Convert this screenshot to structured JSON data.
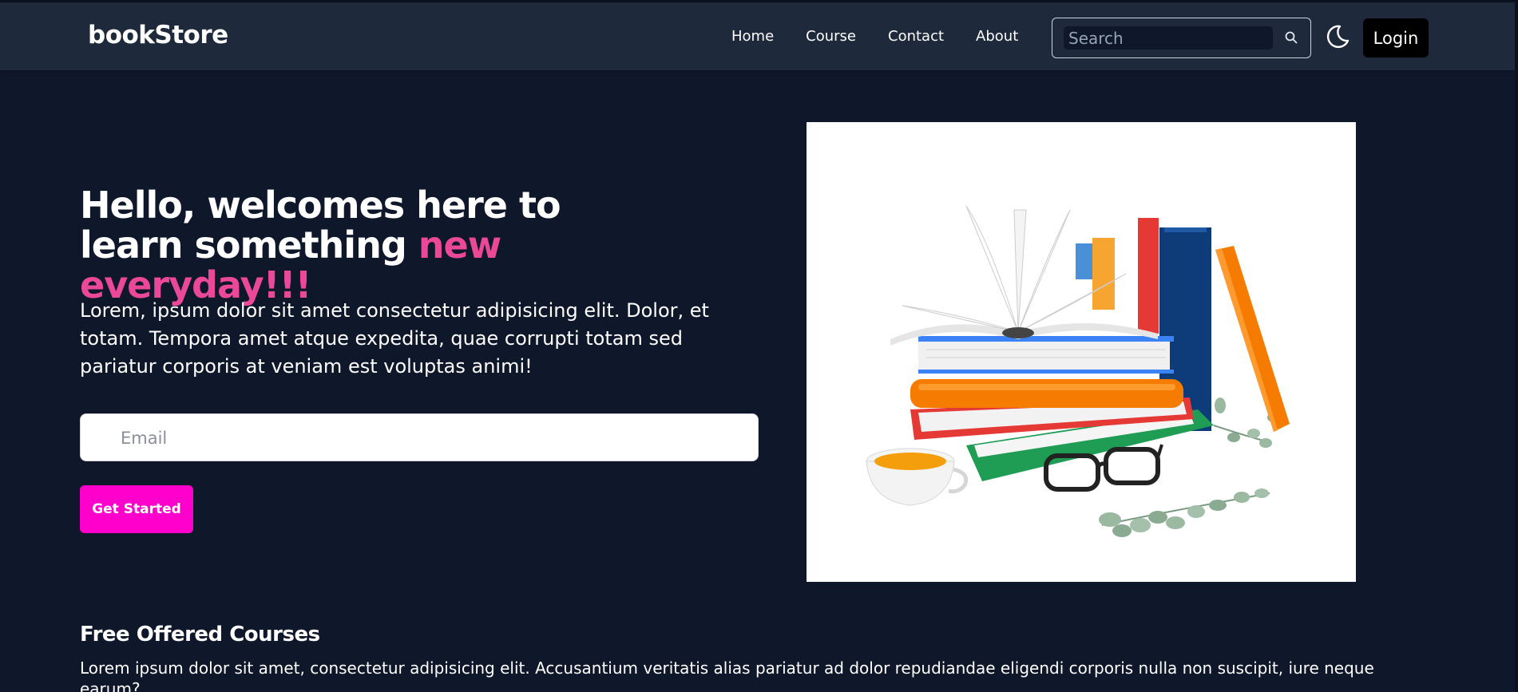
{
  "brand": {
    "logo": "bookStore"
  },
  "nav": {
    "links": [
      "Home",
      "Course",
      "Contact",
      "About"
    ],
    "search_placeholder": "Search",
    "login_label": "Login"
  },
  "hero": {
    "title_main": "Hello, welcomes here to learn something ",
    "title_accent": "new everyday!!!",
    "description": "Lorem, ipsum dolor sit amet consectetur adipisicing elit. Dolor, et totam. Tempora amet atque expedita, quae corrupti totam sed pariatur corporis at veniam est voluptas animi!",
    "email_placeholder": "Email",
    "cta_label": "Get Started"
  },
  "courses": {
    "title": "Free Offered Courses",
    "description": "Lorem ipsum dolor sit amet, consectetur adipisicing elit. Accusantium veritatis alias pariatur ad dolor repudiandae eligendi corporis nulla non suscipit, iure neque earum?"
  },
  "icons": {
    "search": "search-icon",
    "theme_toggle": "moon-icon"
  },
  "colors": {
    "background": "#0f172a",
    "navbar": "#1e293b",
    "accent_text": "#ec4899",
    "cta": "#ff00cc",
    "login_button": "#000000"
  }
}
